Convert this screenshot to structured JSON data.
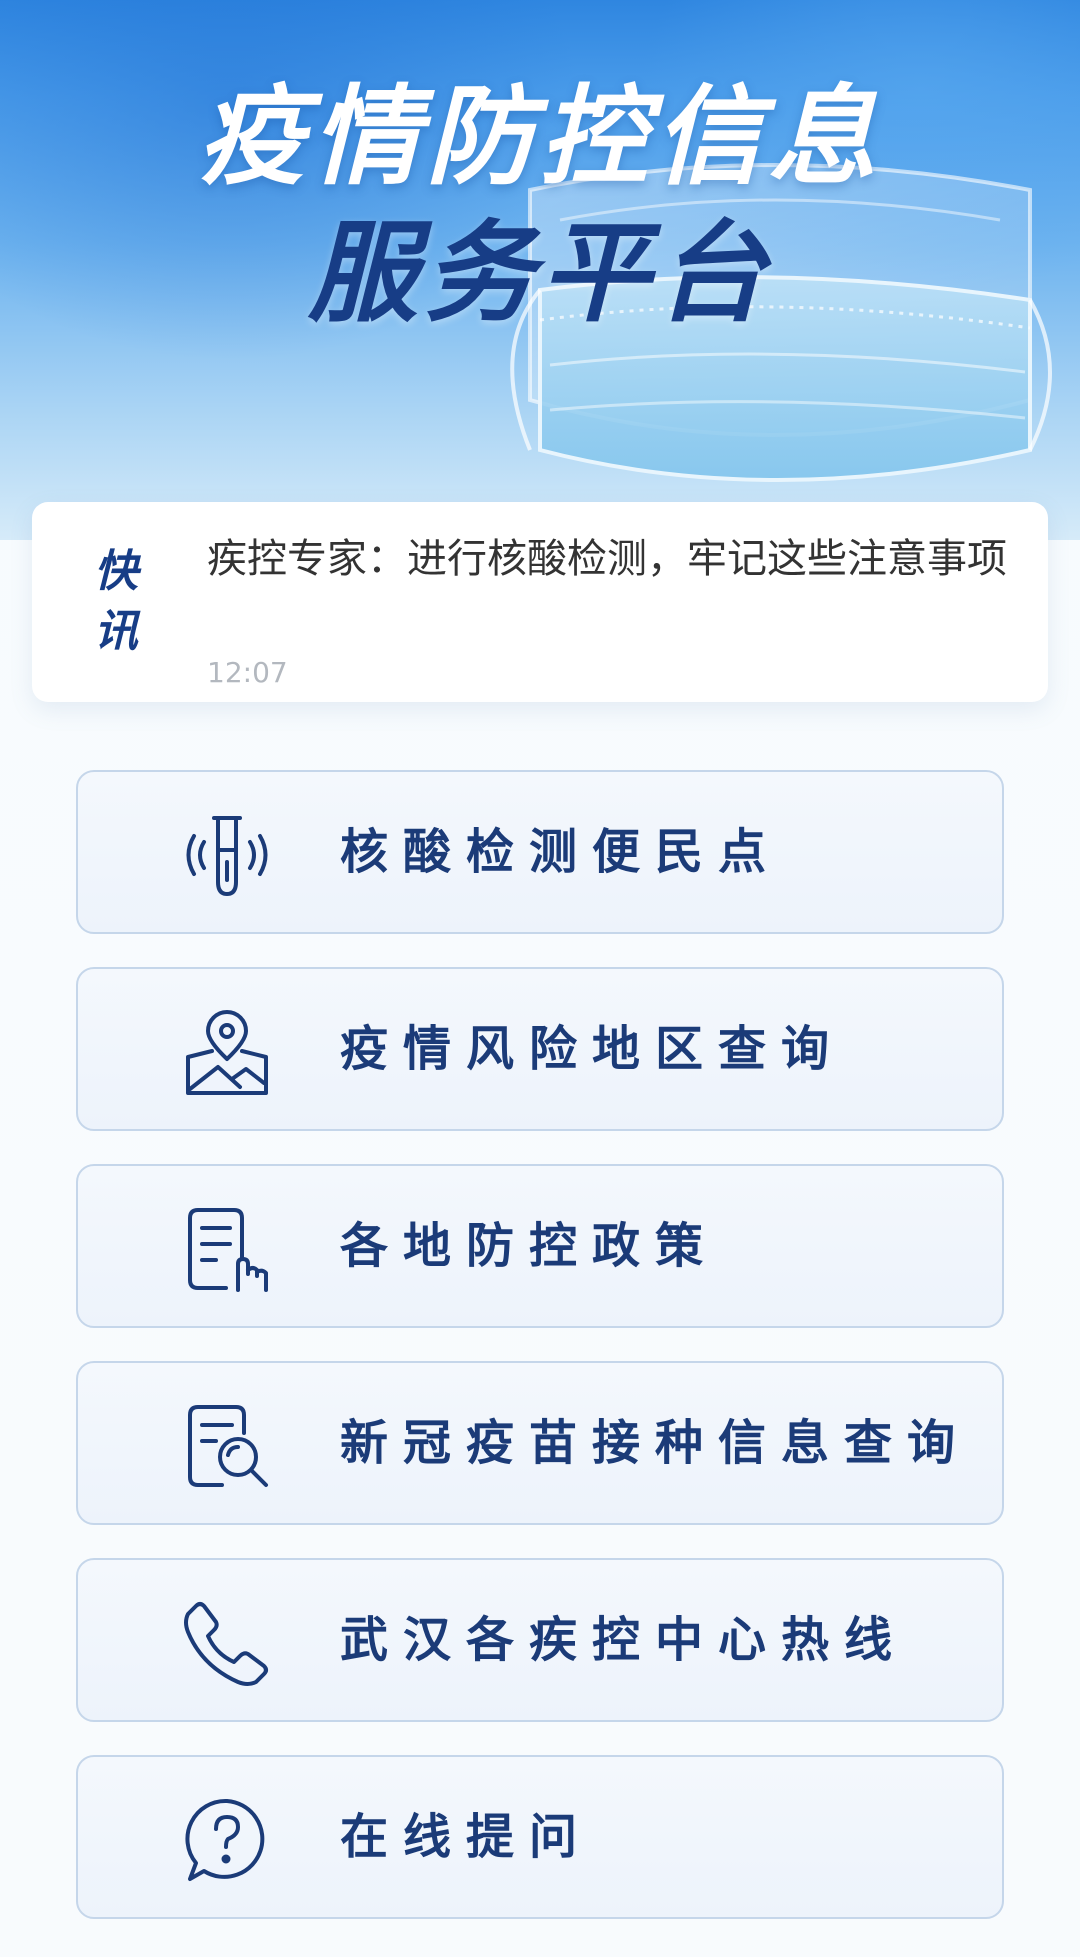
{
  "banner": {
    "title_line1": "疫情防控信息",
    "title_line2": "服务平台"
  },
  "news": {
    "badge_line1": "快",
    "badge_line2": "讯",
    "headline": "疾控专家：进行核酸检测，牢记这些注意事项",
    "time": "12:07"
  },
  "menu": {
    "items": [
      {
        "label": "核酸检测便民点",
        "icon": "test-tube-icon"
      },
      {
        "label": "疫情风险地区查询",
        "icon": "map-pin-icon"
      },
      {
        "label": "各地防控政策",
        "icon": "document-hand-icon"
      },
      {
        "label": "新冠疫苗接种信息查询",
        "icon": "document-search-icon"
      },
      {
        "label": "武汉各疾控中心热线",
        "icon": "phone-icon"
      },
      {
        "label": "在线提问",
        "icon": "question-bubble-icon"
      }
    ]
  },
  "colors": {
    "primary_navy": "#173d86",
    "menu_text": "#1b3b78",
    "menu_border": "#c5d6ea",
    "banner_blue": "#4a9cea",
    "news_time": "#b3b8bf"
  }
}
